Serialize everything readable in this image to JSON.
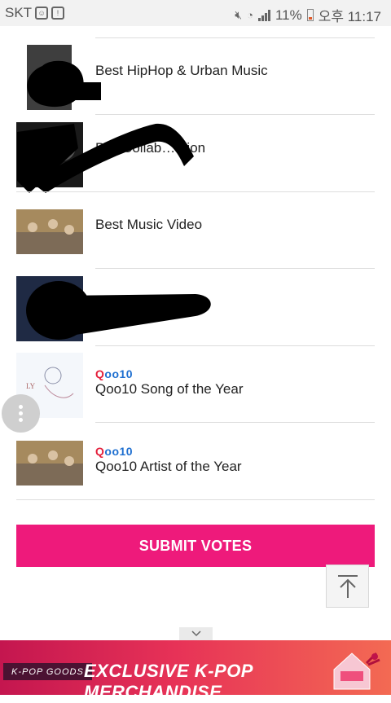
{
  "status_bar": {
    "carrier": "SKT",
    "battery": "11%",
    "time": "오후 11:17"
  },
  "categories": [
    {
      "label": "Best HipHop & Urban Music",
      "brand": ""
    },
    {
      "label": "B… Collab…ation",
      "brand": ""
    },
    {
      "label": "Best Music Video",
      "brand": ""
    },
    {
      "label": "",
      "brand": ""
    },
    {
      "label": "Qoo10 Song of the Year",
      "brand": "Qoo10"
    },
    {
      "label": "Qoo10 Artist of the Year",
      "brand": "Qoo10"
    }
  ],
  "submit_label": "SUBMIT VOTES",
  "banner": {
    "tag": "K-POP GOODS",
    "headline": "EXCLUSIVE K-POP MERCHANDISE"
  },
  "colors": {
    "submit_bg": "#ee1a7b",
    "brand_red": "#e31e3a",
    "brand_blue": "#1e6fd0"
  }
}
